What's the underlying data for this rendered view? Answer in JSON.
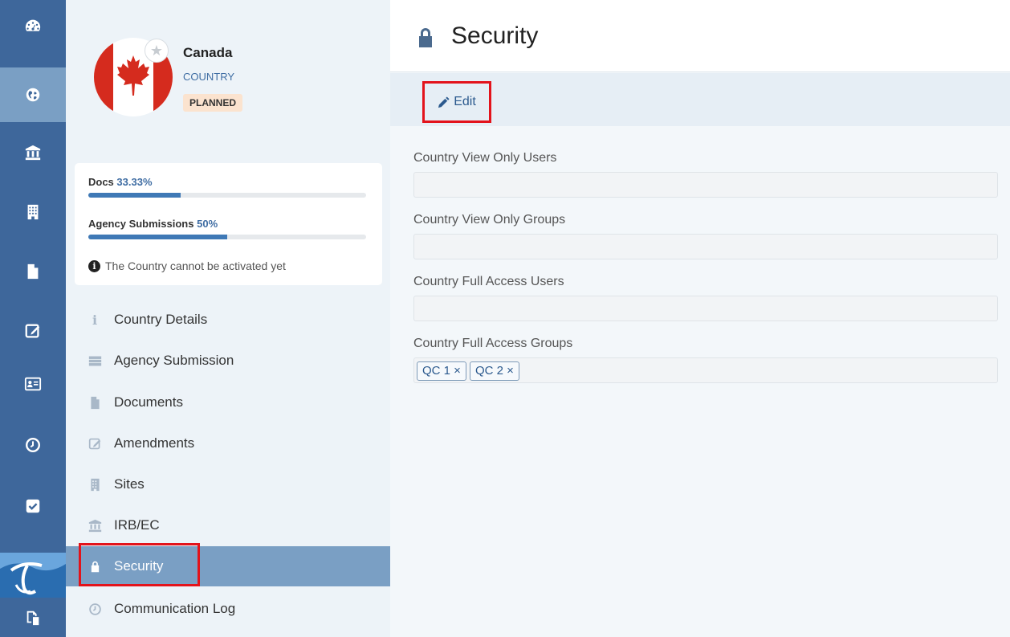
{
  "rail": {
    "items": [
      {
        "name": "dashboard-icon"
      },
      {
        "name": "globe-icon"
      },
      {
        "name": "institution-icon"
      },
      {
        "name": "building-icon"
      },
      {
        "name": "document-icon"
      },
      {
        "name": "edit-icon"
      },
      {
        "name": "contact-card-icon"
      },
      {
        "name": "clock-icon"
      },
      {
        "name": "checkbox-icon"
      },
      {
        "name": "copy-icon"
      }
    ],
    "active_index": 1,
    "logo": "app-logo"
  },
  "profile": {
    "name": "Canada",
    "type": "COUNTRY",
    "status": "PLANNED",
    "flag_colors": {
      "red": "#d52b1e",
      "white": "#ffffff"
    }
  },
  "progress": {
    "docs_label": "Docs",
    "docs_pct": "33.33%",
    "docs_value": 33.33,
    "agency_label": "Agency Submissions",
    "agency_pct": "50%",
    "agency_value": 50,
    "note": "The Country cannot be activated yet"
  },
  "nav": {
    "items": [
      {
        "label": "Country Details",
        "icon": "info-icon"
      },
      {
        "label": "Agency Submission",
        "icon": "server-icon"
      },
      {
        "label": "Documents",
        "icon": "document-icon"
      },
      {
        "label": "Amendments",
        "icon": "edit-icon"
      },
      {
        "label": "Sites",
        "icon": "building-icon"
      },
      {
        "label": "IRB/EC",
        "icon": "institution-icon"
      },
      {
        "label": "Security",
        "icon": "lock-icon"
      },
      {
        "label": "Communication Log",
        "icon": "clock-icon"
      }
    ],
    "active_index": 6
  },
  "main": {
    "title": "Security",
    "edit_label": "Edit",
    "fields": [
      {
        "label": "Country View Only Users",
        "tags": []
      },
      {
        "label": "Country View Only Groups",
        "tags": []
      },
      {
        "label": "Country Full Access Users",
        "tags": []
      },
      {
        "label": "Country Full Access Groups",
        "tags": [
          "QC 1 ×",
          "QC 2 ×"
        ]
      }
    ]
  },
  "colors": {
    "rail_bg": "#3e679b",
    "active_bg": "#7a9fc4",
    "accent": "#3f6da3",
    "highlight": "#e3131b"
  }
}
